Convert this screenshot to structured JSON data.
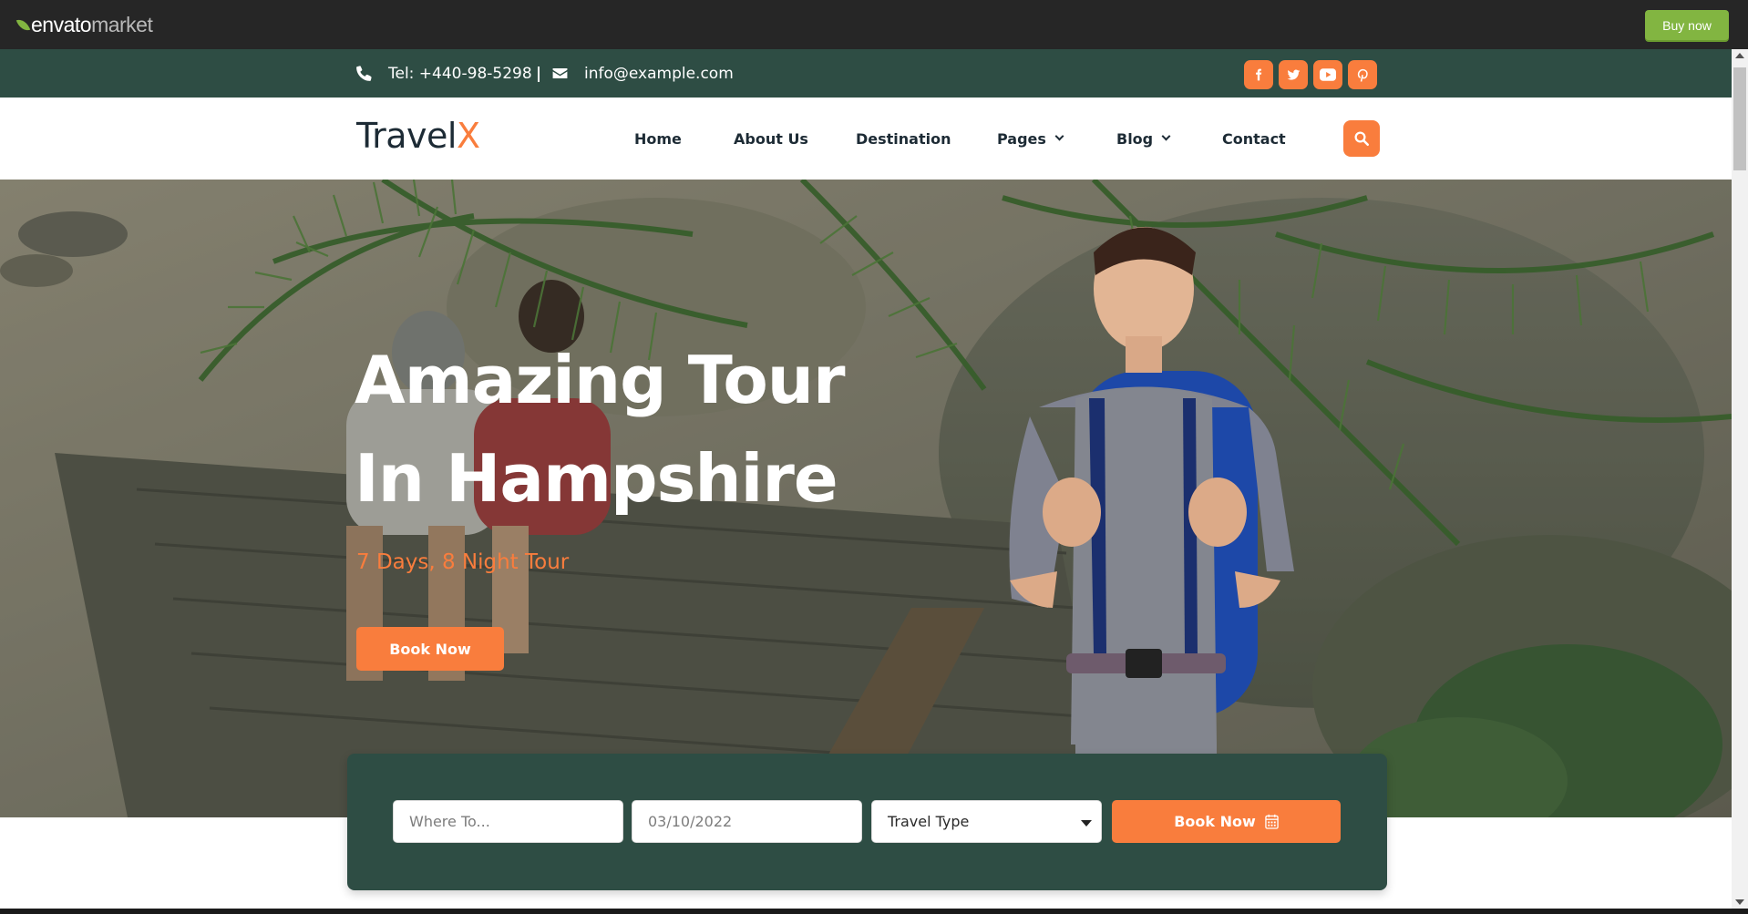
{
  "envato": {
    "logo_primary": "envato",
    "logo_secondary": "market",
    "buy_now": "Buy now",
    "accent": "#82b541"
  },
  "topbar": {
    "phone": "Tel: +440-98-5298",
    "email": "info@example.com",
    "socials": [
      "facebook-icon",
      "twitter-icon",
      "youtube-icon",
      "pinterest-icon"
    ],
    "background": "#2e4d44"
  },
  "header": {
    "brand_main": "Travel",
    "brand_accent": "X",
    "nav": [
      {
        "label": "Home"
      },
      {
        "label": "About Us"
      },
      {
        "label": "Destination"
      },
      {
        "label": "Pages",
        "dropdown": true
      },
      {
        "label": "Blog",
        "dropdown": true
      },
      {
        "label": "Contact"
      }
    ],
    "search_icon": "search-icon"
  },
  "hero": {
    "title_line1": "Amazing Tour",
    "title_line2": "In Hampshire",
    "subtitle": "7 Days, 8 Night Tour",
    "cta": "Book Now"
  },
  "booking": {
    "where_placeholder": "Where To...",
    "date_value": "03/10/2022",
    "travel_type": "Travel Type",
    "submit_label": "Book Now",
    "submit_icon": "calendar-icon"
  },
  "colors": {
    "accent": "#f97d3d",
    "dark_green": "#2e4d44",
    "text_dark": "#1d2b35"
  }
}
